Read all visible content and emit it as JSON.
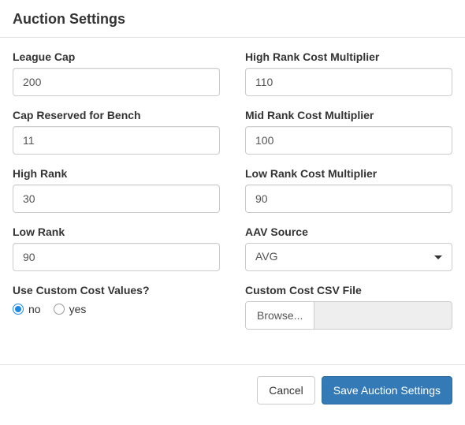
{
  "header": {
    "title": "Auction Settings"
  },
  "left": {
    "league_cap": {
      "label": "League Cap",
      "value": "200"
    },
    "cap_reserved": {
      "label": "Cap Reserved for Bench",
      "value": "11"
    },
    "high_rank": {
      "label": "High Rank",
      "value": "30"
    },
    "low_rank": {
      "label": "Low Rank",
      "value": "90"
    },
    "custom_toggle": {
      "label": "Use Custom Cost Values?",
      "options": {
        "no": "no",
        "yes": "yes"
      },
      "selected": "no"
    }
  },
  "right": {
    "high_mult": {
      "label": "High Rank Cost Multiplier",
      "value": "110"
    },
    "mid_mult": {
      "label": "Mid Rank Cost Multiplier",
      "value": "100"
    },
    "low_mult": {
      "label": "Low Rank Cost Multiplier",
      "value": "90"
    },
    "aav_source": {
      "label": "AAV Source",
      "selected": "AVG"
    },
    "csv": {
      "label": "Custom Cost CSV File",
      "browse_label": "Browse..."
    }
  },
  "footer": {
    "cancel": "Cancel",
    "save": "Save Auction Settings"
  }
}
